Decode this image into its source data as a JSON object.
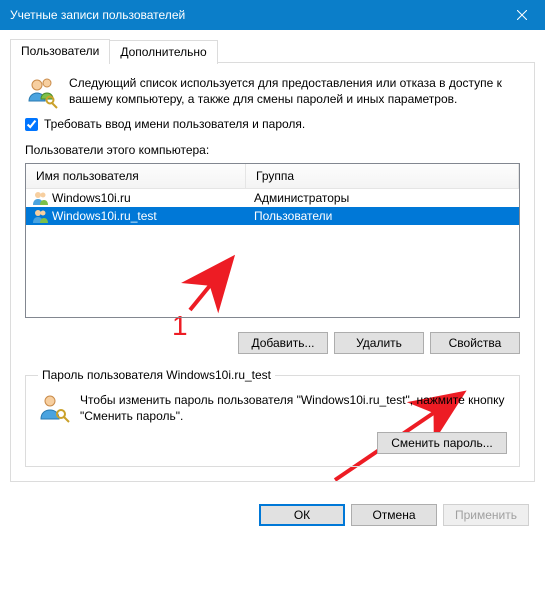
{
  "titlebar": {
    "title": "Учетные записи пользователей"
  },
  "tabs": {
    "users": "Пользователи",
    "advanced": "Дополнительно"
  },
  "intro": "Следующий список используется для предоставления или отказа в доступе к вашему компьютеру, а также для смены паролей и иных параметров.",
  "require_login_label": "Требовать ввод имени пользователя и пароля.",
  "users_of_computer_label": "Пользователи этого компьютера:",
  "columns": {
    "name": "Имя пользователя",
    "group": "Группа"
  },
  "rows": [
    {
      "name": "Windows10i.ru",
      "group": "Администраторы"
    },
    {
      "name": "Windows10i.ru_test",
      "group": "Пользователи"
    }
  ],
  "buttons": {
    "add": "Добавить...",
    "remove": "Удалить",
    "properties": "Свойства"
  },
  "password_box": {
    "legend": "Пароль пользователя Windows10i.ru_test",
    "text": "Чтобы изменить пароль пользователя \"Windows10i.ru_test\", нажмите кнопку \"Сменить пароль\".",
    "change_pw": "Сменить пароль..."
  },
  "dialog": {
    "ok": "ОК",
    "cancel": "Отмена",
    "apply": "Применить"
  },
  "annotation": {
    "label": "1"
  }
}
